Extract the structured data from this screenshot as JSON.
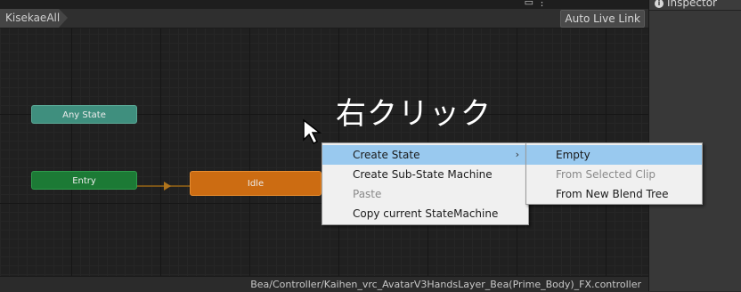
{
  "window": {
    "icons": [
      "panel-menu-icon",
      "more-options-icon"
    ]
  },
  "inspector": {
    "tab_label": "Inspector",
    "tab_icon": "info-icon"
  },
  "breadcrumb": {
    "layer": "KisekaeAll"
  },
  "toolbar": {
    "auto_live_link": "Auto Live Link"
  },
  "graph": {
    "nodes": {
      "any_state": "Any State",
      "entry": "Entry",
      "idle": "Idle"
    },
    "colors": {
      "any_state": "#3f8f7e",
      "entry": "#1c7a35",
      "idle": "#cc6c12",
      "transition": "#b0741c"
    }
  },
  "annotation": {
    "text": "右クリック",
    "pointer_icon": "mouse-cursor-icon"
  },
  "context_menu": {
    "items": [
      {
        "label": "Create State",
        "has_submenu": true,
        "highlighted": true,
        "disabled": false
      },
      {
        "label": "Create Sub-State Machine",
        "has_submenu": false,
        "highlighted": false,
        "disabled": false
      },
      {
        "label": "Paste",
        "has_submenu": false,
        "highlighted": false,
        "disabled": true
      },
      {
        "label": "Copy current StateMachine",
        "has_submenu": false,
        "highlighted": false,
        "disabled": false
      }
    ],
    "submenu_arrow": "›"
  },
  "submenu": {
    "items": [
      {
        "label": "Empty",
        "highlighted": true,
        "disabled": false
      },
      {
        "label": "From Selected Clip",
        "highlighted": false,
        "disabled": true
      },
      {
        "label": "From New Blend Tree",
        "highlighted": false,
        "disabled": false
      }
    ]
  },
  "status": {
    "path": "Bea/Controller/Kaihen_vrc_AvatarV3HandsLayer_Bea(Prime_Body)_FX.controller"
  }
}
